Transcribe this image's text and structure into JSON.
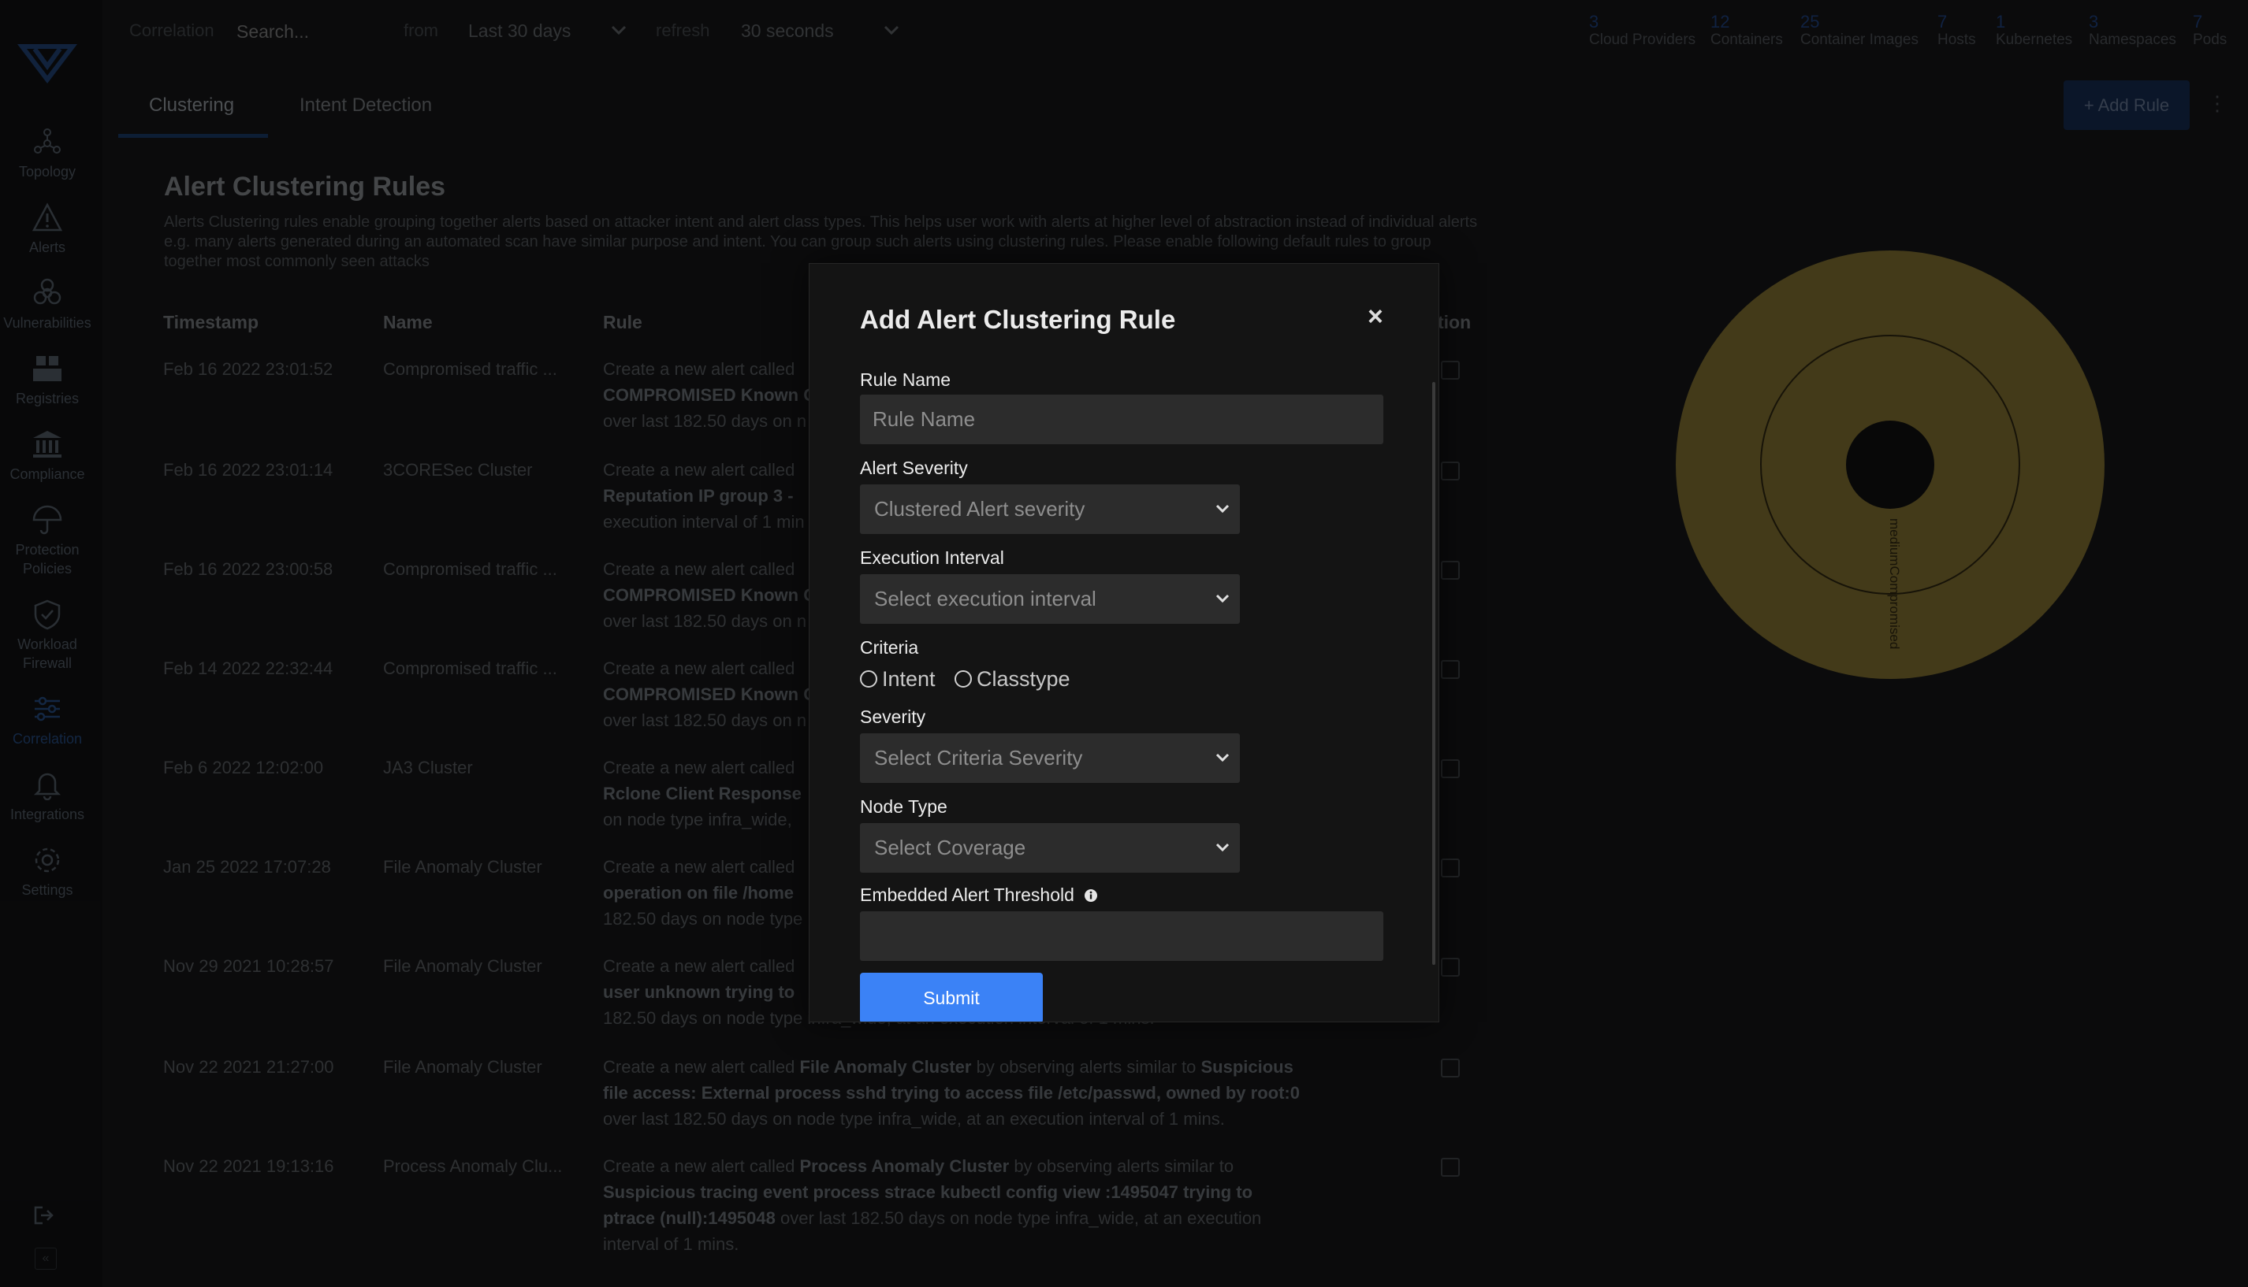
{
  "topbar": {
    "correlation_label": "Correlation",
    "search_placeholder": "Search...",
    "from_label": "from",
    "from_value": "Last 30 days",
    "refresh_label": "refresh",
    "refresh_value": "30 seconds",
    "stats": [
      {
        "num": "3",
        "label": "Cloud Providers"
      },
      {
        "num": "12",
        "label": "Containers"
      },
      {
        "num": "25",
        "label": "Container Images"
      },
      {
        "num": "7",
        "label": "Hosts"
      },
      {
        "num": "1",
        "label": "Kubernetes"
      },
      {
        "num": "3",
        "label": "Namespaces"
      },
      {
        "num": "7",
        "label": "Pods"
      }
    ]
  },
  "sidebar": {
    "items": [
      {
        "label": "Topology",
        "icon": "topology-icon"
      },
      {
        "label": "Alerts",
        "icon": "alert-triangle-icon"
      },
      {
        "label": "Vulnerabilities",
        "icon": "biohazard-icon"
      },
      {
        "label": "Registries",
        "icon": "registries-icon"
      },
      {
        "label": "Compliance",
        "icon": "bank-icon"
      },
      {
        "label": "Protection",
        "label2": "Policies",
        "icon": "umbrella-icon"
      },
      {
        "label": "Workload",
        "label2": "Firewall",
        "icon": "shield-icon"
      },
      {
        "label": "Correlation",
        "icon": "sliders-icon"
      },
      {
        "label": "Integrations",
        "icon": "bell-icon"
      },
      {
        "label": "Settings",
        "icon": "gear-icon"
      }
    ]
  },
  "tabs": [
    {
      "label": "Clustering"
    },
    {
      "label": "Intent Detection"
    }
  ],
  "add_rule_label": "+ Add Rule",
  "kebab": "⋮",
  "page": {
    "title": "Alert Clustering Rules",
    "description": "Alerts Clustering rules enable grouping together alerts based on attacker intent and alert class types. This helps user work with alerts at higher level of abstraction instead of individual alerts e.g. many alerts generated during an automated scan have similar purpose and intent. You can group such alerts using clustering rules. Please enable following default rules to group together most commonly seen attacks"
  },
  "table": {
    "headers": [
      "Timestamp",
      "Name",
      "Rule",
      "tion"
    ],
    "rows": [
      {
        "timestamp": "Feb 16 2022 23:01:52",
        "name": "Compromised traffic ...",
        "rule_pre": "Create a new alert called",
        "rule_bold": "COMPROMISED Known C",
        "rule_post": "over last 182.50 days on n"
      },
      {
        "timestamp": "Feb 16 2022 23:01:14",
        "name": "3CORESec Cluster",
        "rule_pre": "Create a new alert called",
        "rule_bold": "Reputation IP group 3 -",
        "rule_post": "execution interval of 1 min"
      },
      {
        "timestamp": "Feb 16 2022 23:00:58",
        "name": "Compromised traffic ...",
        "rule_pre": "Create a new alert called",
        "rule_bold": "COMPROMISED Known C",
        "rule_post": "over last 182.50 days on n"
      },
      {
        "timestamp": "Feb 14 2022 22:32:44",
        "name": "Compromised traffic ...",
        "rule_pre": "Create a new alert called",
        "rule_bold": "COMPROMISED Known C",
        "rule_post": "over last 182.50 days on n"
      },
      {
        "timestamp": "Feb 6 2022 12:02:00",
        "name": "JA3 Cluster",
        "rule_pre": "Create a new alert called",
        "rule_bold": "Rclone Client Response",
        "rule_post": "on node type infra_wide,"
      },
      {
        "timestamp": "Jan 25 2022 17:07:28",
        "name": "File Anomaly Cluster",
        "rule_pre": "Create a new alert called",
        "rule_bold": "operation on file /home",
        "rule_post": "182.50 days on node type"
      },
      {
        "timestamp": "Nov 29 2021 10:28:57",
        "name": "File Anomaly Cluster",
        "rule_pre": "Create a new alert called",
        "rule_bold": "user unknown trying to",
        "rule_post": "182.50 days on node type infra_wide, at an execution interval of 1 mins."
      },
      {
        "timestamp": "Nov 22 2021 21:27:00",
        "name": "File Anomaly Cluster",
        "rule_l1a": "Create a new alert called ",
        "rule_l1b": "File Anomaly Cluster",
        "rule_l1c": " by observing alerts similar to ",
        "rule_l1d": "Suspicious",
        "rule_l2": "file access: External process sshd trying to access file /etc/passwd, owned by root:0",
        "rule_l3": "over last 182.50 days on node type infra_wide, at an execution interval of 1 mins."
      },
      {
        "timestamp": "Nov 22 2021 19:13:16",
        "name": "Process Anomaly Clu...",
        "rule_l1a": "Create a new alert called ",
        "rule_l1b": "Process Anomaly Cluster",
        "rule_l1c": " by observing alerts similar to",
        "rule_l2": "Suspicious tracing event process strace kubectl config view :1495047 trying to",
        "rule_l3a": "ptrace (null):1495048",
        "rule_l3b": " over last 182.50 days on node type infra_wide, at an execution",
        "rule_l4": "interval of 1 mins."
      }
    ]
  },
  "donut_chart": {
    "label": "mediumCompromised",
    "color": "#7a6a2e"
  },
  "modal": {
    "title": "Add Alert Clustering Rule",
    "close": "×",
    "rule_name_label": "Rule Name",
    "rule_name_placeholder": "Rule Name",
    "alert_severity_label": "Alert Severity",
    "alert_severity_value": "Clustered Alert severity",
    "execution_interval_label": "Execution Interval",
    "execution_interval_value": "Select execution interval",
    "criteria_label": "Criteria",
    "criteria_options": [
      "Intent",
      "Classtype"
    ],
    "severity_label": "Severity",
    "severity_value": "Select Criteria Severity",
    "node_type_label": "Node Type",
    "node_type_value": "Select Coverage",
    "threshold_label": "Embedded Alert Threshold",
    "submit_label": "Submit"
  },
  "colors": {
    "accent": "#3b82f6",
    "donut": "#7a6a2e",
    "modal_bg": "#141414"
  }
}
